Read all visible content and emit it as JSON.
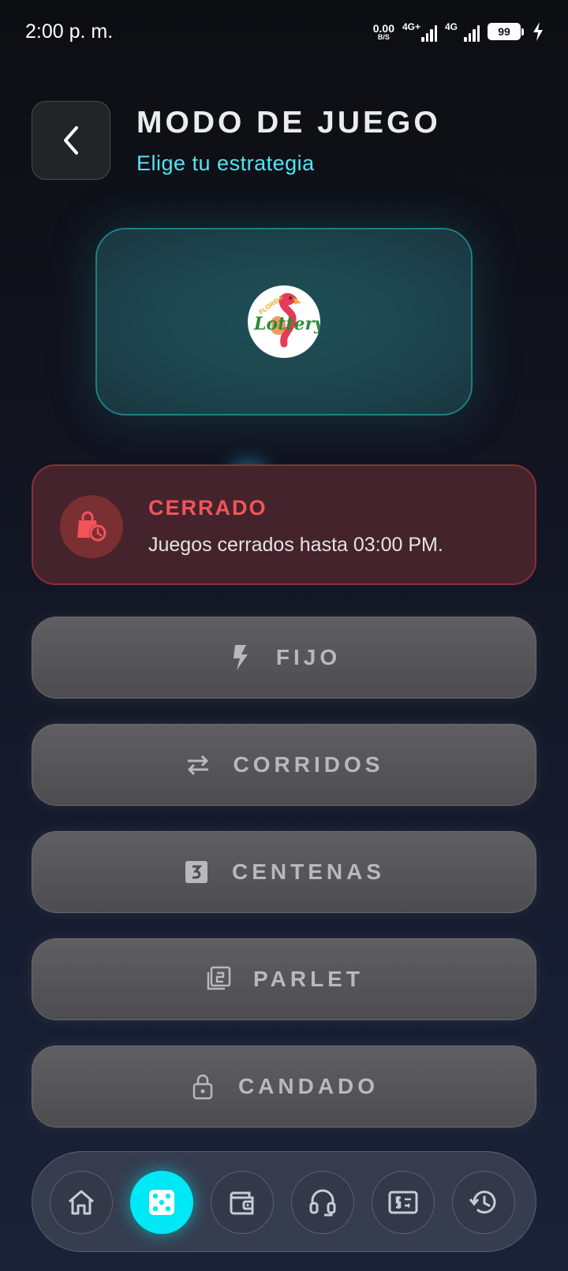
{
  "status_bar": {
    "time": "2:00 p. m.",
    "net_speed_value": "0.00",
    "net_speed_unit": "B/S",
    "network1": "4G+",
    "network2": "4G",
    "battery": "99"
  },
  "header": {
    "title": "MODO DE JUEGO",
    "subtitle": "Elige tu estrategia"
  },
  "lottery_logo": {
    "small_text": "FLORIDA",
    "main_text": "Lottery"
  },
  "status_card": {
    "title": "CERRADO",
    "message": "Juegos cerrados hasta 03:00 PM."
  },
  "modes": [
    {
      "label": "FIJO",
      "icon": "lightning-icon"
    },
    {
      "label": "CORRIDOS",
      "icon": "swap-arrows-icon"
    },
    {
      "label": "CENTENAS",
      "icon": "number-three-box-icon"
    },
    {
      "label": "PARLET",
      "icon": "stacked-two-icon"
    },
    {
      "label": "CANDADO",
      "icon": "lock-icon"
    }
  ],
  "bottom_nav": [
    {
      "icon": "home-icon",
      "active": false
    },
    {
      "icon": "dice-icon",
      "active": true
    },
    {
      "icon": "wallet-icon",
      "active": false
    },
    {
      "icon": "headset-icon",
      "active": false
    },
    {
      "icon": "money-bill-icon",
      "active": false
    },
    {
      "icon": "history-icon",
      "active": false
    }
  ],
  "colors": {
    "accent": "#00e7f5",
    "subtitle": "#4ee6f0",
    "closed_red": "#f0555b"
  }
}
